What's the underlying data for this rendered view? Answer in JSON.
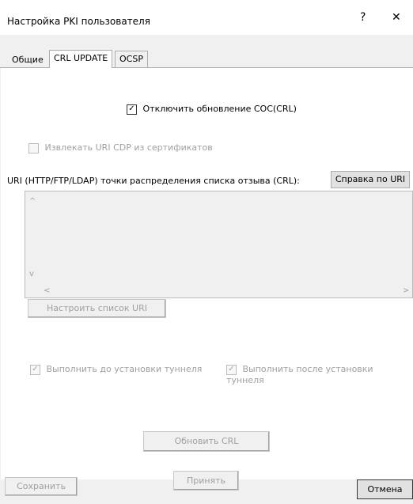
{
  "window": {
    "title": "Настройка PKI пользователя",
    "help": "?",
    "close": "✕"
  },
  "tabs": [
    {
      "label": "Общие"
    },
    {
      "label": "CRL UPDATE"
    },
    {
      "label": "OCSP"
    }
  ],
  "crl": {
    "disable_update": {
      "label": "Отключить обновление СОС(CRL)",
      "checked": true,
      "mark": "✓"
    },
    "extract_cdp": {
      "label": "Извлекать URI CDP из сертификатов",
      "checked": false
    },
    "uri_label": "URI (HTTP/FTP/LDAP) точки распределения списка отзыва (CRL):",
    "uri_help_button": "Справка по URI",
    "configure_uri_button": "Настроить список URI",
    "run_before": {
      "label": "Выполнить до установки туннеля",
      "checked": true,
      "mark": "✓"
    },
    "run_after": {
      "label": "Выполнить после установки туннеля",
      "checked": true,
      "mark": "✓"
    },
    "update_button": "Обновить CRL",
    "apply_button": "Принять"
  },
  "scroll": {
    "up": "^",
    "down": "v",
    "left": "<",
    "right": ">"
  },
  "footer": {
    "save_button": "Сохранить",
    "cancel_button": "Отмена"
  }
}
